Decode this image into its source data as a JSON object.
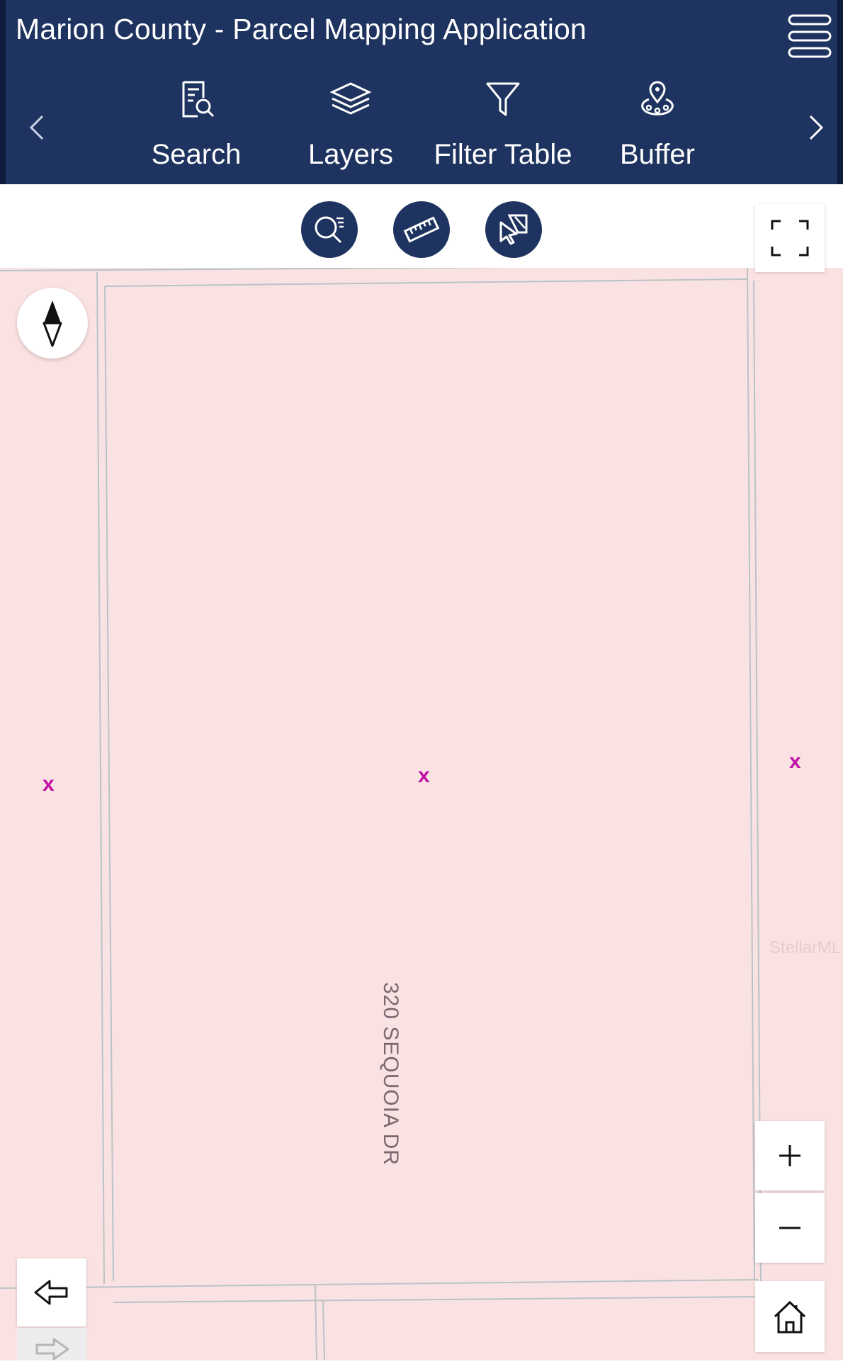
{
  "header": {
    "title": "Marion County - Parcel Mapping Application",
    "menu_icon": "hamburger-menu-icon",
    "prev_icon": "chevron-left-icon",
    "next_icon": "chevron-right-icon"
  },
  "toolbar": {
    "items": [
      {
        "label": "Search",
        "icon": "search-document-icon"
      },
      {
        "label": "Layers",
        "icon": "layers-icon"
      },
      {
        "label": "Filter Table",
        "icon": "filter-icon"
      },
      {
        "label": "Buffer",
        "icon": "buffer-pin-icon"
      }
    ]
  },
  "subtools": [
    "zoom-search-icon",
    "ruler-measure-icon",
    "select-cursor-icon"
  ],
  "map": {
    "street_label": "320 SEQUOIA DR",
    "markers": [
      "x",
      "x",
      "x"
    ],
    "watermark": "StellarMLS",
    "controls": [
      "compass-icon",
      "fullscreen-icon",
      "zoom-in-icon",
      "zoom-out-icon",
      "home-icon",
      "back-arrow-icon"
    ]
  },
  "colors": {
    "header_bg": "#1e335f",
    "parcel_fill": "#fbe2e2",
    "marker": "#c010a8"
  }
}
